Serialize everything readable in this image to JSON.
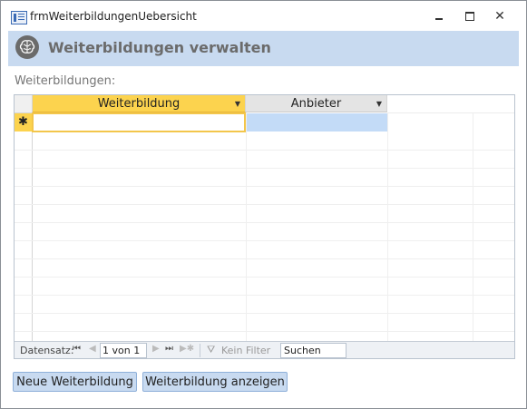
{
  "window": {
    "title": "frmWeiterbildungenUebersicht",
    "minimize": "minimize",
    "maximize": "maximize",
    "close": "✕"
  },
  "header": {
    "icon": "brain-icon",
    "title": "Weiterbildungen verwalten"
  },
  "list_label": "Weiterbildungen:",
  "grid": {
    "columns": [
      {
        "label": "Weiterbildung",
        "state": "selected"
      },
      {
        "label": "Anbieter",
        "state": "normal"
      }
    ],
    "new_row_marker": "✱",
    "rows": []
  },
  "navigation": {
    "label": "Datensatz:",
    "first": "⏮",
    "prev": "◀",
    "position": "1 von 1",
    "next": "▶",
    "last": "⏭",
    "new": "▶✱",
    "filter_icon": "filter-icon",
    "filter_label": "Kein Filter",
    "search_placeholder": "Suchen"
  },
  "buttons": {
    "new_label": "Neue Weiterbildung",
    "show_label": "Weiterbildung anzeigen"
  },
  "colors": {
    "header_bg": "#c8daf0",
    "selected_column": "#fcd34e",
    "selected_cell": "#c3dbf7"
  }
}
